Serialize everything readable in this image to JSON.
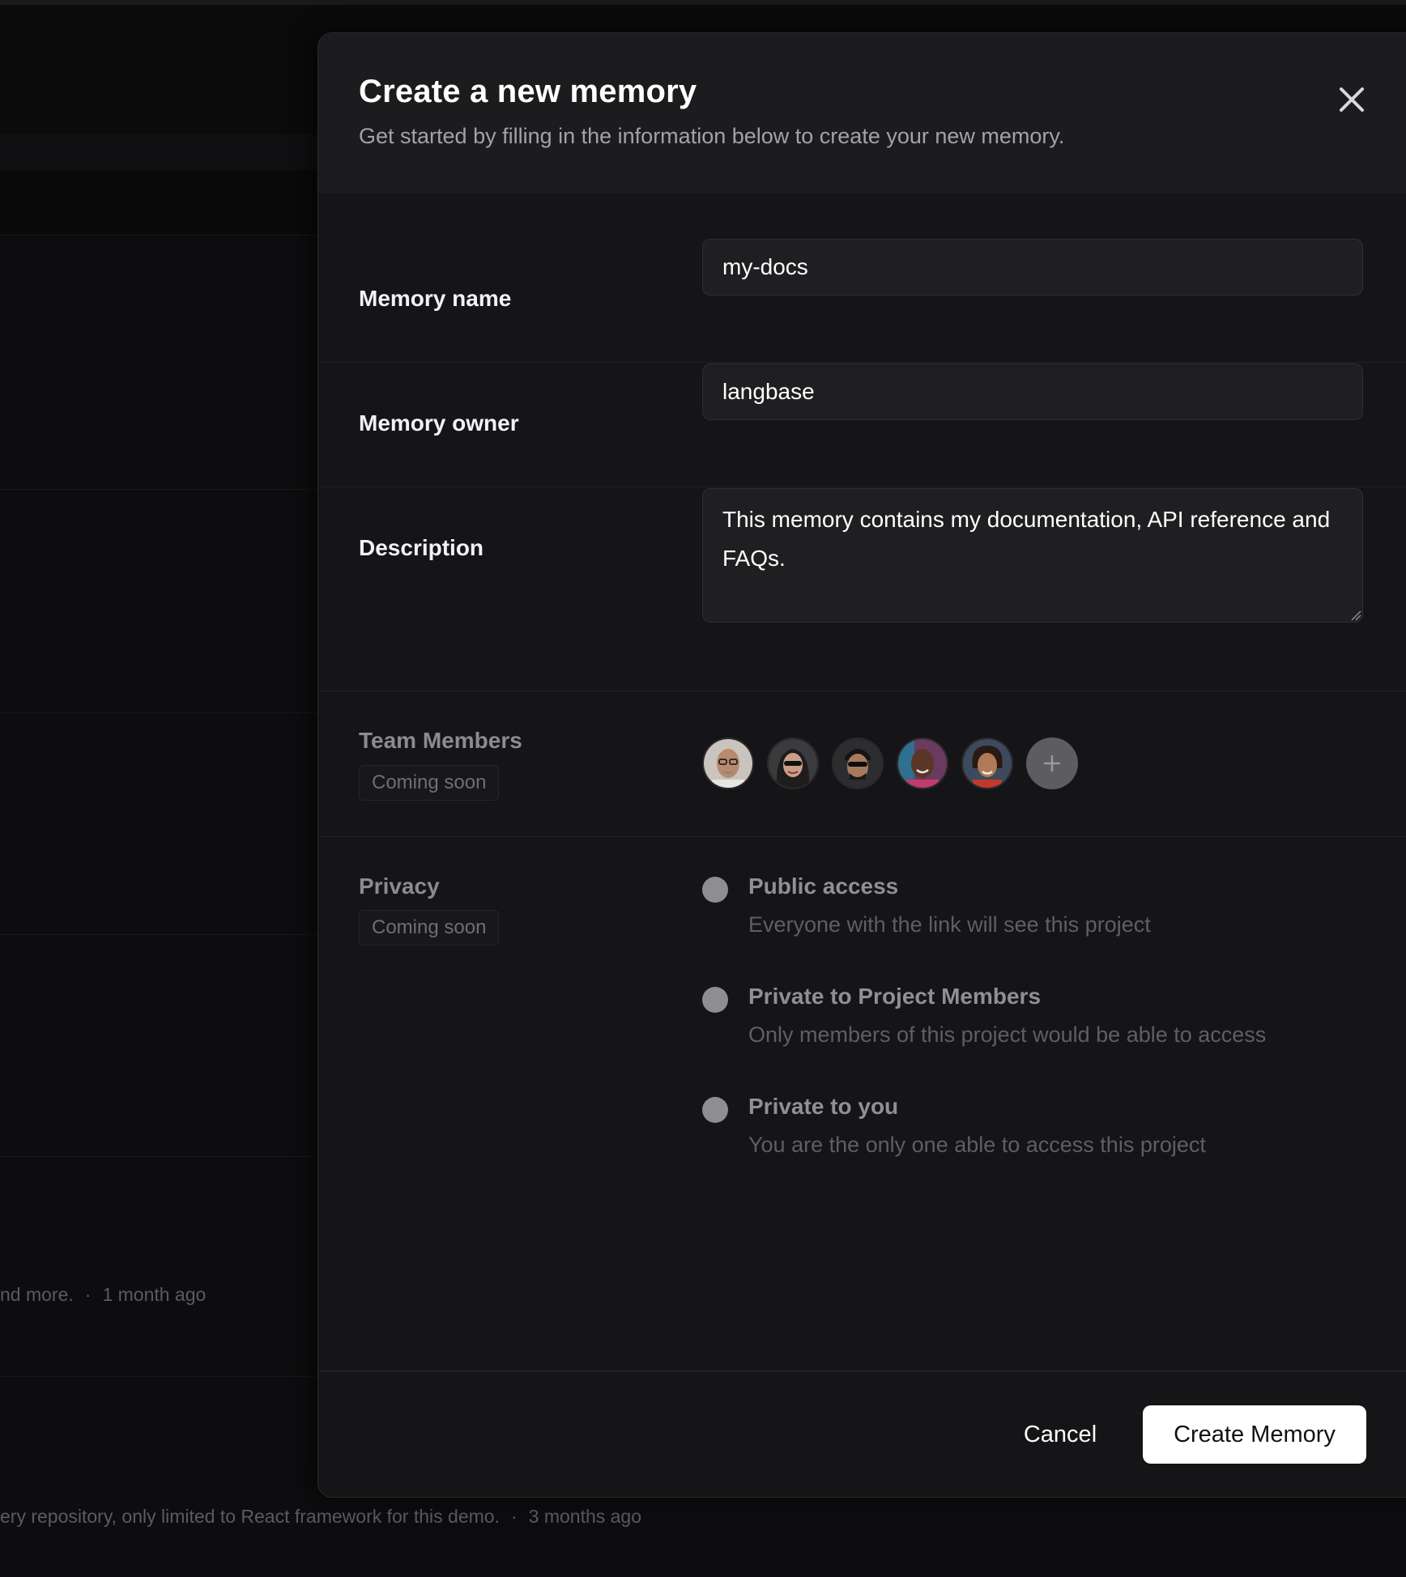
{
  "background": {
    "activity_1": {
      "text": "nd more.",
      "time": "1 month ago"
    },
    "activity_2": {
      "text": "ery repository, only limited to React framework for this demo.",
      "time": "3 months ago"
    },
    "separator": "·"
  },
  "modal": {
    "title": "Create a new memory",
    "subtitle": "Get started by filling in the information below to create your new memory.",
    "close_icon": "close-icon"
  },
  "form": {
    "memory_name": {
      "label": "Memory name",
      "value": "my-docs"
    },
    "memory_owner": {
      "label": "Memory owner",
      "value": "langbase"
    },
    "description": {
      "label": "Description",
      "value": "This memory contains my documentation, API reference and FAQs."
    },
    "team_members": {
      "label": "Team Members",
      "badge": "Coming soon",
      "avatars": [
        "avatar-1",
        "avatar-2",
        "avatar-3",
        "avatar-4",
        "avatar-5"
      ],
      "add_icon": "plus-icon"
    },
    "privacy": {
      "label": "Privacy",
      "badge": "Coming soon",
      "options": [
        {
          "label": "Public access",
          "description": "Everyone with the link will see this project"
        },
        {
          "label": "Private to Project Members",
          "description": "Only members of this project would be able to access"
        },
        {
          "label": "Private to you",
          "description": "You are the only one able to access this project"
        }
      ]
    }
  },
  "footer": {
    "cancel_label": "Cancel",
    "create_label": "Create Memory"
  },
  "colors": {
    "modal_bg": "#151517",
    "header_bg": "#1c1c1f",
    "input_bg": "#1f1f22",
    "primary_button": "#ffffff",
    "radio": "#8d8d92"
  }
}
